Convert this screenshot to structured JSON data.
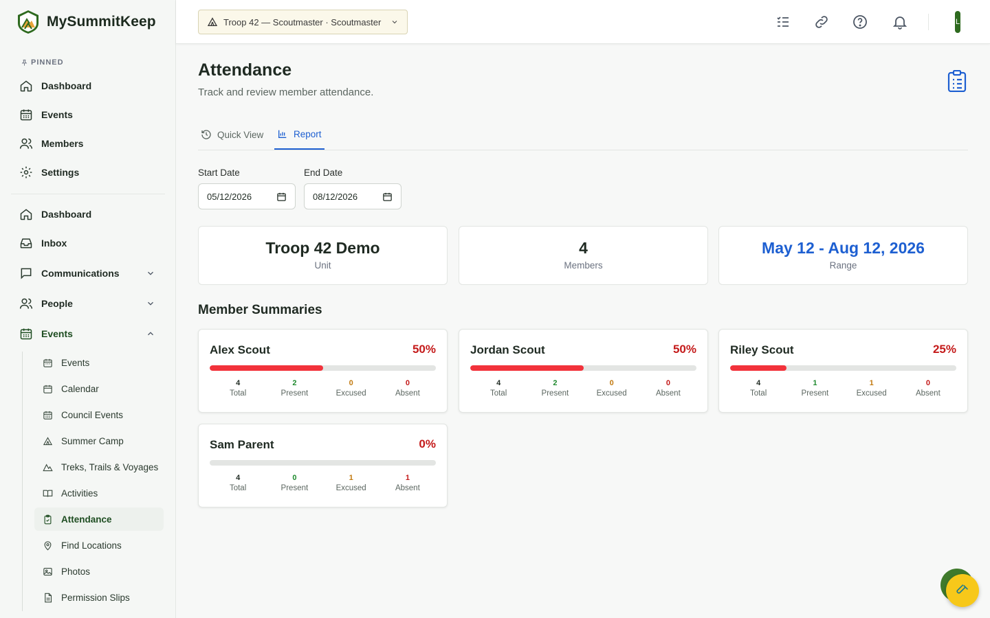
{
  "brand": {
    "name": "MySummitKeep"
  },
  "sidebar": {
    "pinned_label": "PINNED",
    "pinned": [
      {
        "label": "Dashboard",
        "icon": "home-icon"
      },
      {
        "label": "Events",
        "icon": "calendar-icon"
      },
      {
        "label": "Members",
        "icon": "users-icon"
      },
      {
        "label": "Settings",
        "icon": "gear-icon"
      }
    ],
    "main": [
      {
        "label": "Dashboard",
        "icon": "home-icon"
      },
      {
        "label": "Inbox",
        "icon": "inbox-icon"
      },
      {
        "label": "Communications",
        "icon": "message-icon"
      },
      {
        "label": "People",
        "icon": "users-icon"
      },
      {
        "label": "Events",
        "icon": "calendar-icon"
      }
    ],
    "events_sub": [
      {
        "label": "Events"
      },
      {
        "label": "Calendar"
      },
      {
        "label": "Council Events"
      },
      {
        "label": "Summer Camp"
      },
      {
        "label": "Treks, Trails & Voyages"
      },
      {
        "label": "Activities"
      },
      {
        "label": "Attendance"
      },
      {
        "label": "Find Locations"
      },
      {
        "label": "Photos"
      },
      {
        "label": "Permission Slips"
      }
    ]
  },
  "header": {
    "unit_selector": "Troop 42 — Scoutmaster · Scoutmaster",
    "avatar_initial": "L"
  },
  "page": {
    "title": "Attendance",
    "subtitle": "Track and review member attendance."
  },
  "tabs": [
    {
      "label": "Quick View",
      "active": false
    },
    {
      "label": "Report",
      "active": true
    }
  ],
  "filters": {
    "start_label": "Start Date",
    "start_value": "05/12/2026",
    "end_label": "End Date",
    "end_value": "08/12/2026"
  },
  "summary": [
    {
      "value": "Troop 42 Demo",
      "label": "Unit"
    },
    {
      "value": "4",
      "label": "Members"
    },
    {
      "value": "May 12 - Aug 12, 2026",
      "label": "Range"
    }
  ],
  "members_title": "Member Summaries",
  "stat_labels": {
    "total": "Total",
    "present": "Present",
    "excused": "Excused",
    "absent": "Absent"
  },
  "members": [
    {
      "name": "Alex Scout",
      "pct": "50%",
      "rate": 0.5,
      "total": "4",
      "present": "2",
      "excused": "0",
      "absent": "0"
    },
    {
      "name": "Jordan Scout",
      "pct": "50%",
      "rate": 0.5,
      "total": "4",
      "present": "2",
      "excused": "0",
      "absent": "0"
    },
    {
      "name": "Riley Scout",
      "pct": "25%",
      "rate": 0.25,
      "total": "4",
      "present": "1",
      "excused": "1",
      "absent": "0"
    },
    {
      "name": "Sam Parent",
      "pct": "0%",
      "rate": 0,
      "total": "4",
      "present": "0",
      "excused": "1",
      "absent": "1"
    }
  ],
  "colors": {
    "accent": "#1d5fd1",
    "brand_green": "#2e6a1f",
    "progress": "#f2323b",
    "percent": "#c41a1a",
    "present": "#1f8a2e",
    "excused": "#c27a10",
    "fab": "#f7c81a"
  }
}
